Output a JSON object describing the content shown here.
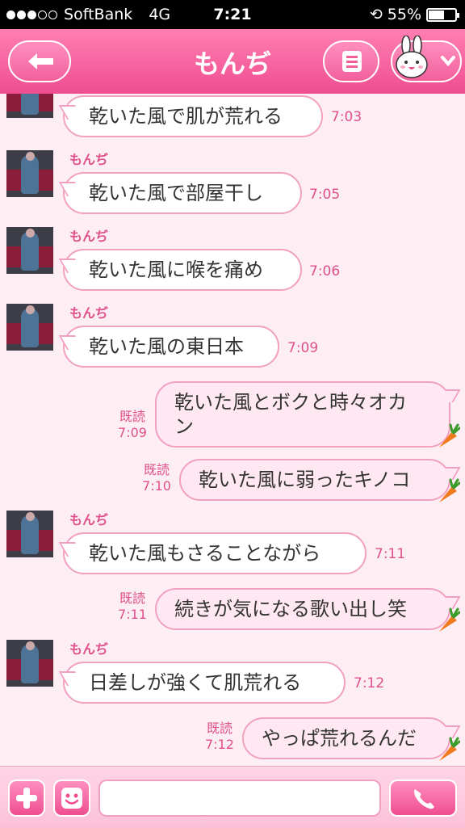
{
  "status_bar": {
    "carrier": "SoftBank",
    "network": "4G",
    "time": "7:21",
    "battery": "55%",
    "battery_level": 0.55
  },
  "header": {
    "title": "もんぢ"
  },
  "messages": [
    {
      "dir": "in",
      "name": "",
      "text": "乾いた風で肌が荒れる",
      "time": "7:03"
    },
    {
      "dir": "in",
      "name": "もんぢ",
      "text": "乾いた風で部屋干し",
      "time": "7:05"
    },
    {
      "dir": "in",
      "name": "もんぢ",
      "text": "乾いた風に喉を痛め",
      "time": "7:06"
    },
    {
      "dir": "in",
      "name": "もんぢ",
      "text": "乾いた風の東日本",
      "time": "7:09"
    },
    {
      "dir": "out",
      "read": "既読",
      "text_line1": "乾いた風とボクと時々オカ",
      "text_line2": "ン",
      "time": "7:09"
    },
    {
      "dir": "out",
      "read": "既読",
      "text": "乾いた風に弱ったキノコ",
      "time": "7:10"
    },
    {
      "dir": "in",
      "name": "もんぢ",
      "text": "乾いた風もさることながら",
      "time": "7:11"
    },
    {
      "dir": "out",
      "read": "既読",
      "text": "続きが気になる歌い出し笑",
      "time": "7:11"
    },
    {
      "dir": "in",
      "name": "もんぢ",
      "text": "日差しが強くて肌荒れる",
      "time": "7:12"
    },
    {
      "dir": "out",
      "read": "既読",
      "text": "やっぱ荒れるんだ",
      "time": "7:12"
    }
  ],
  "icons": {
    "back": "back-arrow-icon",
    "menu": "menu-icon",
    "avatar": "bunny-icon",
    "dropdown": "chevron-down-icon",
    "plus": "plus-icon",
    "sticker": "smiley-icon",
    "call": "phone-icon",
    "carrot": "carrot-icon"
  },
  "colors": {
    "accent": "#ef4d90",
    "background": "#fdeef4",
    "bubble_border": "#f2a0c1"
  }
}
